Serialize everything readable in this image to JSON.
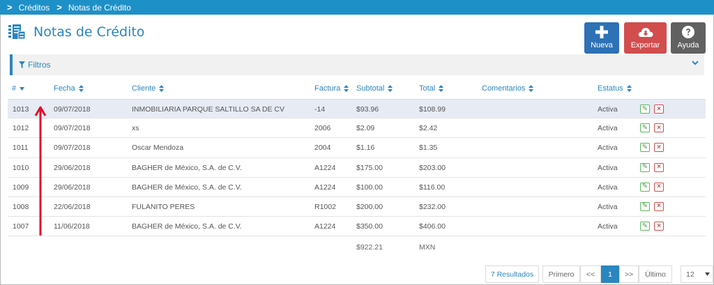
{
  "breadcrumb": [
    {
      "label": "Créditos"
    },
    {
      "label": "Notas de Crédito"
    }
  ],
  "page": {
    "title": "Notas de Crédito"
  },
  "toolbar": {
    "new_label": "Nueva",
    "export_label": "Exportar",
    "help_label": "Ayuda"
  },
  "filters": {
    "label": "Filtros"
  },
  "table": {
    "columns": {
      "num": "#",
      "fecha": "Fecha",
      "cliente": "Cliente",
      "factura": "Factura",
      "subtotal": "Subtotal",
      "total": "Total",
      "comentarios": "Comentarios",
      "estatus": "Estatus"
    },
    "rows": [
      {
        "num": "1013",
        "fecha": "09/07/2018",
        "cliente": "INMOBILIARIA PARQUE SALTILLO SA DE CV",
        "factura": "-14",
        "subtotal": "$93.96",
        "total": "$108.99",
        "comentarios": "",
        "estatus": "Activa"
      },
      {
        "num": "1012",
        "fecha": "09/07/2018",
        "cliente": "xs",
        "factura": "2006",
        "subtotal": "$2.09",
        "total": "$2.42",
        "comentarios": "",
        "estatus": "Activa"
      },
      {
        "num": "1011",
        "fecha": "09/07/2018",
        "cliente": "Oscar Mendoza",
        "factura": "2004",
        "subtotal": "$1.16",
        "total": "$1.35",
        "comentarios": "",
        "estatus": "Activa"
      },
      {
        "num": "1010",
        "fecha": "29/06/2018",
        "cliente": "BAGHER de México, S.A. de C.V.",
        "factura": "A1224",
        "subtotal": "$175.00",
        "total": "$203.00",
        "comentarios": "",
        "estatus": "Activa"
      },
      {
        "num": "1009",
        "fecha": "29/06/2018",
        "cliente": "BAGHER de México, S.A. de C.V.",
        "factura": "A1224",
        "subtotal": "$100.00",
        "total": "$116.00",
        "comentarios": "",
        "estatus": "Activa"
      },
      {
        "num": "1008",
        "fecha": "22/06/2018",
        "cliente": "FULANITO PERES",
        "factura": "R1002",
        "subtotal": "$200.00",
        "total": "$232.00",
        "comentarios": "",
        "estatus": "Activa"
      },
      {
        "num": "1007",
        "fecha": "11/06/2018",
        "cliente": "BAGHER de México, S.A. de C.V.",
        "factura": "A1224",
        "subtotal": "$350.00",
        "total": "$406.00",
        "comentarios": "",
        "estatus": "Activa"
      }
    ],
    "totals": {
      "subtotal": "$922.21",
      "currency": "MXN"
    }
  },
  "pagination": {
    "results": "7 Resultados",
    "first": "Primero",
    "prev": "<<",
    "current": "1",
    "next": ">>",
    "last": "Último",
    "page_size": "12"
  },
  "colors": {
    "accent": "#2a86bf",
    "header_bar": "#1e90c8",
    "new_button": "#2d71b6",
    "export_button": "#d24d4d",
    "help_button": "#616161",
    "annotation_arrow": "#e0102a"
  },
  "icons": {
    "title": "document-list-icon",
    "new": "plus-icon",
    "export": "cloud-download-icon",
    "help": "question-circle-icon",
    "filter": "filter-icon",
    "edit": "edit-icon",
    "delete": "delete-icon"
  }
}
